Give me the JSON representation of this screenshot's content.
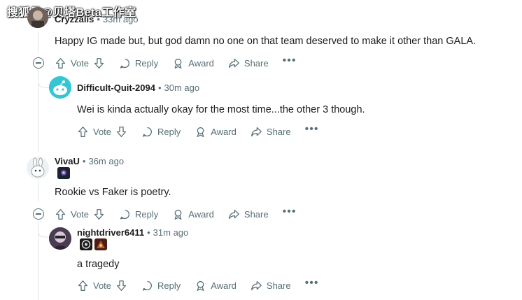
{
  "watermark": "搜狐号@贝塔Beta工作室",
  "comments": [
    {
      "author": "Cryzzalis",
      "time": "33m ago",
      "body": "Happy IG made but, but god damn no one on that team deserved to make it other than GALA."
    },
    {
      "author": "Difficult-Quit-2094",
      "time": "30m ago",
      "body": "Wei is kinda actually okay for the most time...the other 3 though."
    },
    {
      "author": "VivaU",
      "time": "36m ago",
      "body": "Rookie vs Faker is poetry."
    },
    {
      "author": "nightdriver6411",
      "time": "31m ago",
      "body": "a tragedy"
    }
  ],
  "actions": {
    "vote": "Vote",
    "reply": "Reply",
    "award": "Award",
    "share": "Share",
    "more": "•••"
  },
  "separator": "•",
  "icons": [
    "upvote-icon",
    "downvote-icon",
    "reply-icon",
    "award-icon",
    "share-icon",
    "more-icon",
    "collapse-icon"
  ],
  "colors": {
    "meta": "#576f76",
    "thread_line": "#e0e4e6",
    "snoo_bg": "#34c6d3"
  }
}
